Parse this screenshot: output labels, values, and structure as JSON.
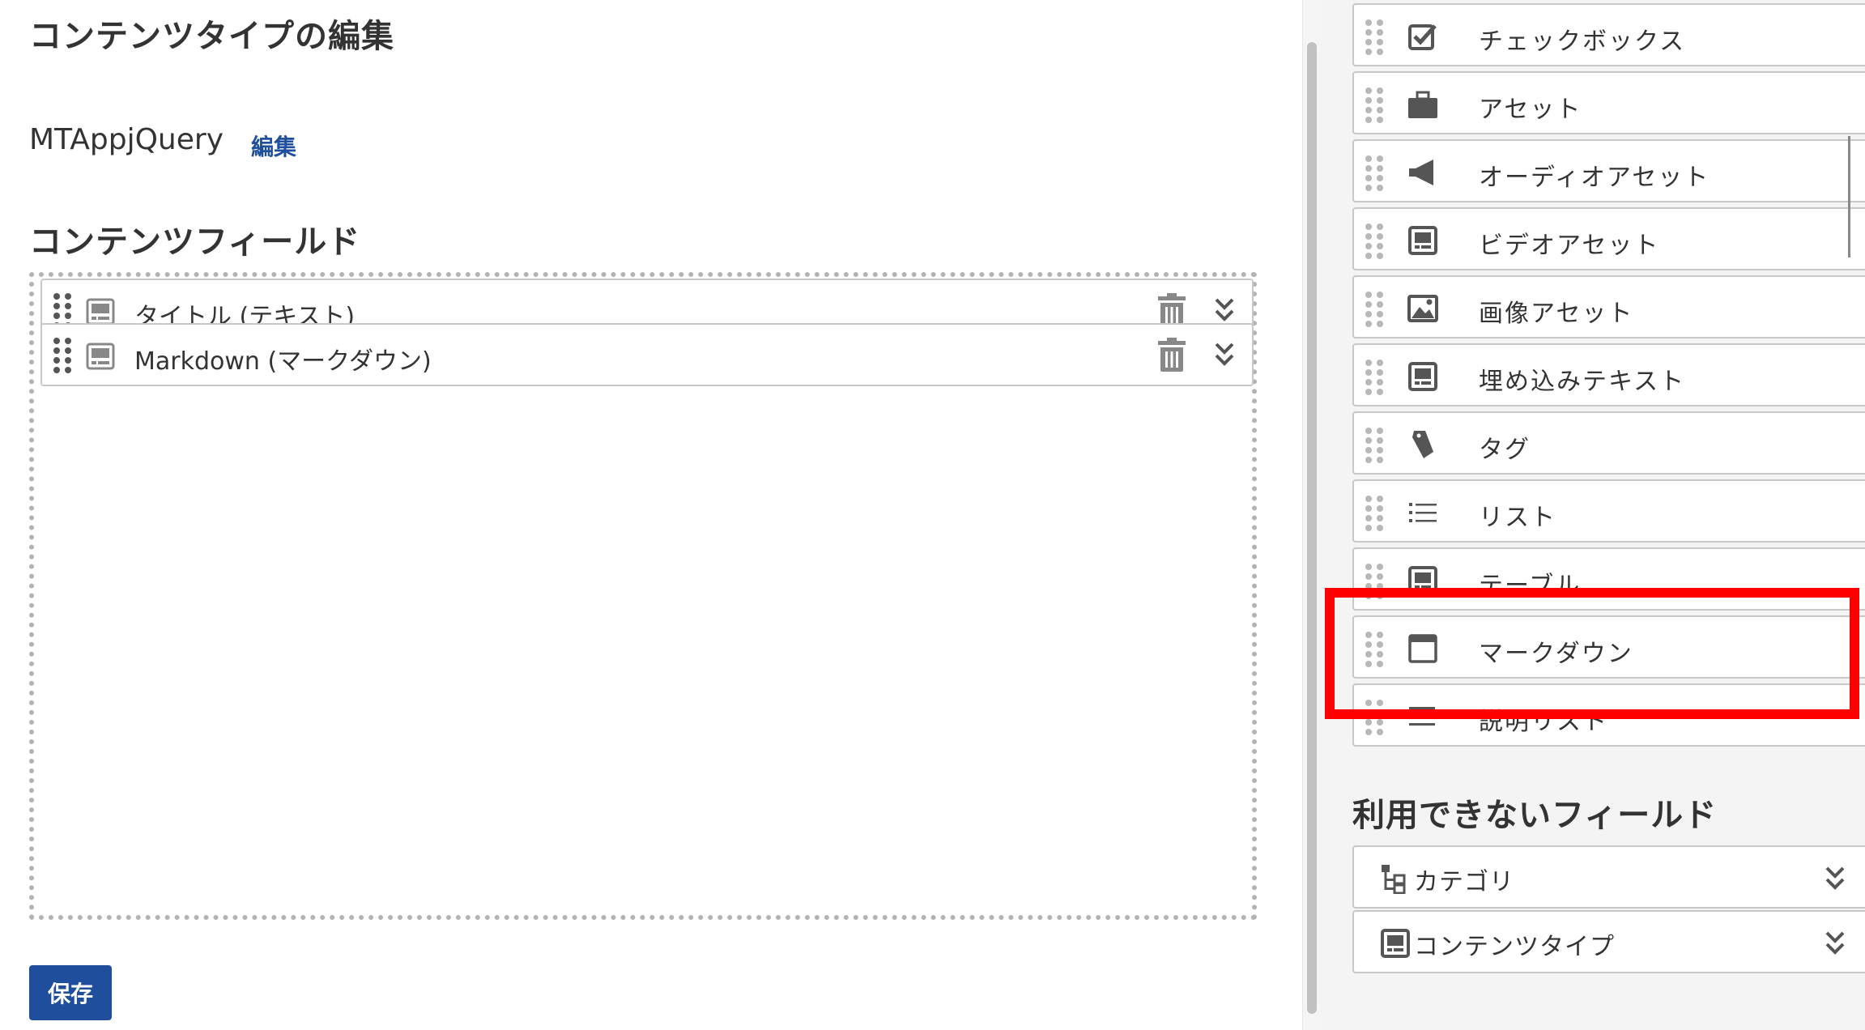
{
  "page": {
    "title": "コンテンツタイプの編集",
    "content_type_name": "MTAppjQuery",
    "edit_link": "編集",
    "fields_section_title": "コンテンツフィールド",
    "save_label": "保存"
  },
  "content_fields": [
    {
      "label": "タイトル (テキスト)",
      "icon": "text-field-icon"
    },
    {
      "label": "Markdown (マークダウン)",
      "icon": "text-field-icon"
    }
  ],
  "field_types": [
    {
      "label": "チェックボックス",
      "icon": "checkbox-icon"
    },
    {
      "label": "アセット",
      "icon": "briefcase-icon"
    },
    {
      "label": "オーディオアセット",
      "icon": "speaker-icon"
    },
    {
      "label": "ビデオアセット",
      "icon": "video-icon"
    },
    {
      "label": "画像アセット",
      "icon": "image-icon"
    },
    {
      "label": "埋め込みテキスト",
      "icon": "embed-text-icon"
    },
    {
      "label": "タグ",
      "icon": "tag-icon"
    },
    {
      "label": "リスト",
      "icon": "list-icon"
    },
    {
      "label": "テーブル",
      "icon": "table-icon"
    },
    {
      "label": "マークダウン",
      "icon": "markdown-window-icon"
    },
    {
      "label": "説明リスト",
      "icon": "description-list-icon"
    }
  ],
  "unavailable": {
    "title": "利用できないフィールド",
    "items": [
      {
        "label": "カテゴリ",
        "icon": "category-tree-icon"
      },
      {
        "label": "コンテンツタイプ",
        "icon": "content-type-icon"
      }
    ]
  },
  "colors": {
    "accent": "#1f4f9c",
    "highlight": "#ff0000"
  }
}
